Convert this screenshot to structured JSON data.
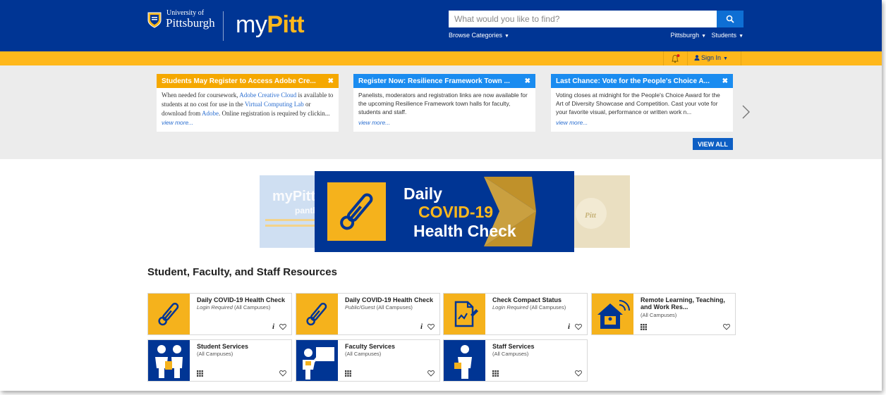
{
  "header": {
    "university_small": "University of",
    "university_big": "Pittsburgh",
    "brand_my": "my",
    "brand_pitt": "Pitt",
    "search_placeholder": "What would you like to find?",
    "browse_label": "Browse Categories",
    "campus_label": "Pittsburgh",
    "role_label": "Students"
  },
  "topbar": {
    "signin_label": "Sign In"
  },
  "announcements": {
    "cards": [
      {
        "title": "Students May Register to Access Adobe Cre...",
        "body_1": "When needed for coursework, ",
        "link_1": "Adobe Creative Cloud",
        "body_2": " is available to students at no cost for use in the ",
        "link_2": "Virtual Computing Lab",
        "body_3": " or download from ",
        "link_3": "Adobe",
        "body_4": ". Online registration is required by clickin...",
        "view_more": "view more...",
        "color": "#f5a800"
      },
      {
        "title": "Register Now: Resilience Framework Town ...",
        "body": "Panelists, moderators and registration links are now available for the upcoming Resilience Framework town halls for faculty, students and staff.",
        "view_more": "view more...",
        "color": "#1a8cf0"
      },
      {
        "title": "Last Chance: Vote for the People's Choice A...",
        "body": "Voting closes at midnight for the People's Choice Award for the Art of Diversity Showcase and Competition. Cast your vote for your favorite visual, performance or written work n...",
        "view_more": "view more...",
        "color": "#1a8cf0"
      }
    ],
    "view_all": "VIEW ALL"
  },
  "banner": {
    "line1": "Daily",
    "line2": "COVID-19",
    "line3": "Health Check",
    "bg_left_text": "myPitt",
    "bg_left_sub": "panther",
    "bg_right_text": "Pitt"
  },
  "resources": {
    "title": "Student, Faculty, and Staff Resources",
    "tiles": [
      {
        "name": "Daily COVID-19 Health Check",
        "access": "Login Required",
        "campus": "(All Campuses)"
      },
      {
        "name": "Daily COVID-19 Health Check",
        "access": "Public/Guest",
        "campus": "(All Campuses)"
      },
      {
        "name": "Check Compact Status",
        "access": "Login Required",
        "campus": "(All Campuses)"
      },
      {
        "name": "Remote Learning, Teaching, and Work Res...",
        "access": "",
        "campus": "(All Campuses)"
      },
      {
        "name": "Student Services",
        "access": "",
        "campus": "(All Campuses)"
      },
      {
        "name": "Faculty Services",
        "access": "",
        "campus": "(All Campuses)"
      },
      {
        "name": "Staff Services",
        "access": "",
        "campus": "(All Campuses)"
      }
    ],
    "info_label": "i"
  },
  "colors": {
    "pitt_blue": "#003594",
    "pitt_gold": "#ffb81c",
    "accent_blue": "#1a8cf0"
  }
}
